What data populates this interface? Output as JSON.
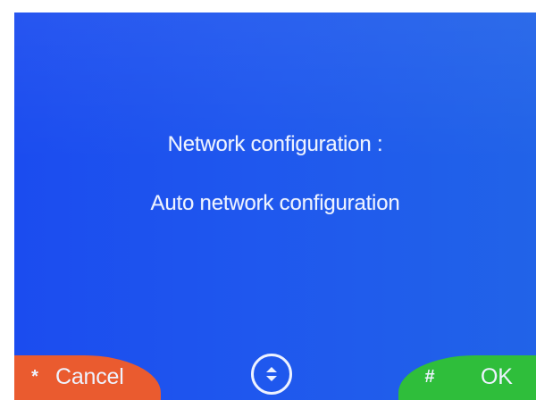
{
  "screen": {
    "title": "Network configuration :",
    "value": "Auto network configuration"
  },
  "softkeys": {
    "cancel": {
      "symbol": "*",
      "label": "Cancel",
      "color": "#ea5b2f"
    },
    "ok": {
      "symbol": "#",
      "label": "OK",
      "color": "#2fbe3b"
    }
  },
  "navigation": {
    "icon": "up-down-arrows-icon"
  },
  "colors": {
    "screen_background": "#1f57ee",
    "text": "#eef3ff"
  }
}
